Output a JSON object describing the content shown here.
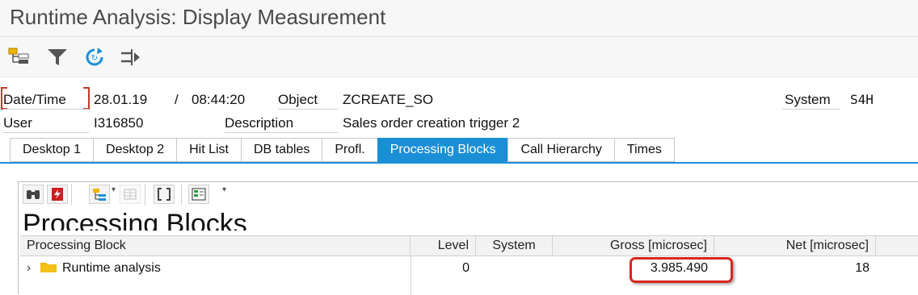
{
  "window": {
    "title": "Runtime Analysis: Display Measurement"
  },
  "toolbar": {
    "icons": [
      "hierarchy-icon",
      "filter-icon",
      "refresh-icon",
      "compare-icon"
    ]
  },
  "header": {
    "datetime_label": "Date/Time",
    "date_value": "28.01.19",
    "separator": "/",
    "time_value": "08:44:20",
    "object_label": "Object",
    "object_value": "ZCREATE_SO",
    "system_label": "System",
    "system_value": "S4H",
    "user_label": "User",
    "user_value": "I316850",
    "description_label": "Description",
    "description_value": "Sales order creation trigger 2"
  },
  "tabs": [
    {
      "label": "Desktop 1",
      "active": false
    },
    {
      "label": "Desktop 2",
      "active": false
    },
    {
      "label": "Hit List",
      "active": false
    },
    {
      "label": "DB tables",
      "active": false
    },
    {
      "label": "Profl.",
      "active": false
    },
    {
      "label": "Processing Blocks",
      "active": true
    },
    {
      "label": "Call Hierarchy",
      "active": false
    },
    {
      "label": "Times",
      "active": false
    }
  ],
  "panel": {
    "heading": "Processing Blocks",
    "columns": {
      "block": "Processing Block",
      "level": "Level",
      "system": "System",
      "gross": "Gross [microsec]",
      "net": "Net [microsec]"
    },
    "rows": [
      {
        "expander": "›",
        "block": "Runtime analysis",
        "level": "0",
        "system": "",
        "gross": "3.985.490",
        "net": "18"
      }
    ]
  },
  "colors": {
    "accent": "#1b8fd6",
    "highlight": "#d9261c",
    "folder": "#f0b400"
  }
}
